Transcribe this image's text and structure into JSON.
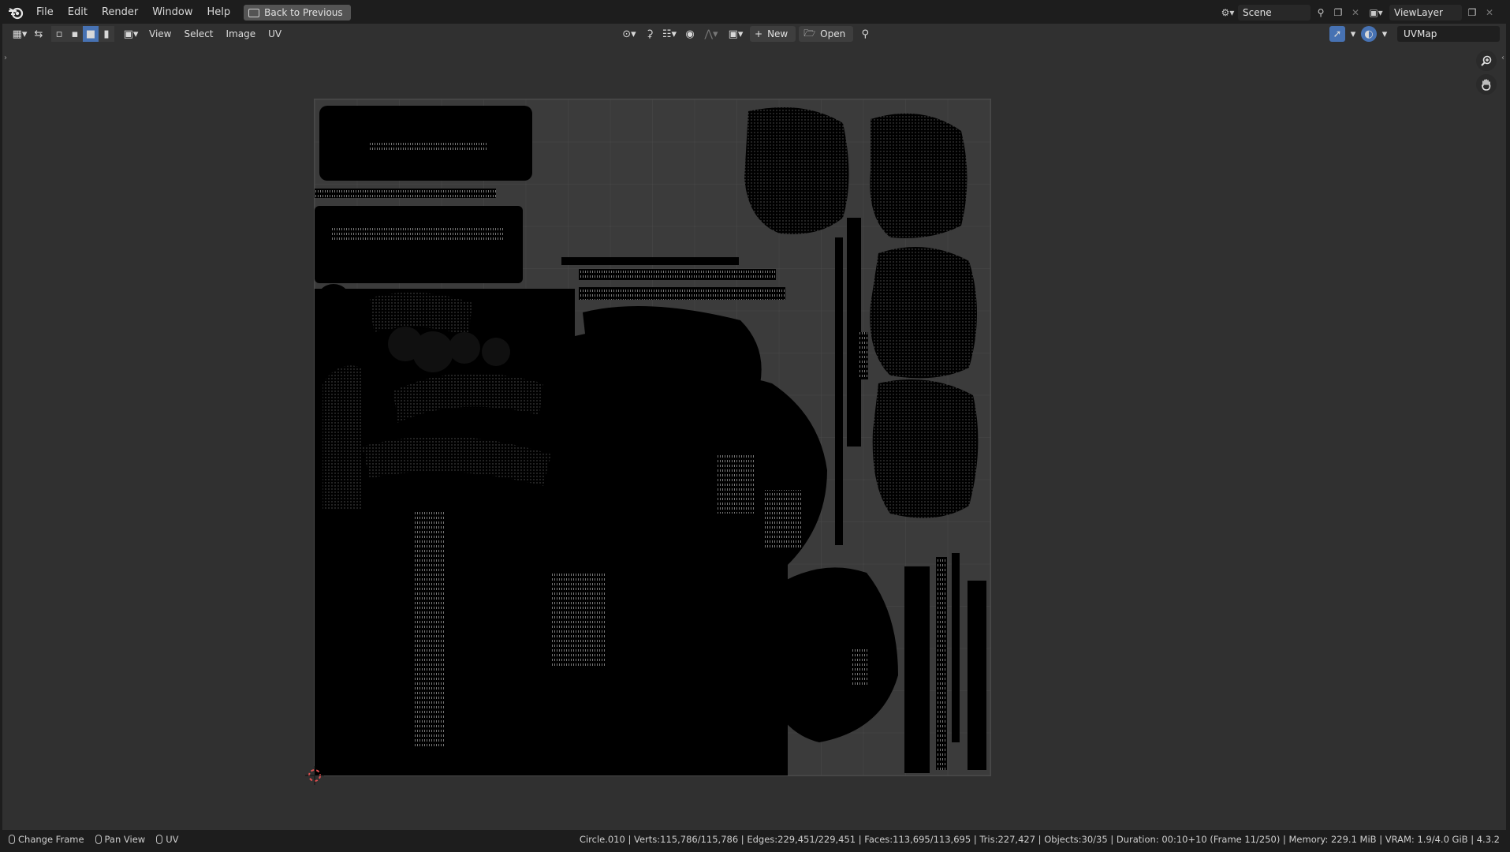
{
  "topbar": {
    "menus": [
      "File",
      "Edit",
      "Render",
      "Window",
      "Help"
    ],
    "back_label": "Back to Previous",
    "scene_name": "Scene",
    "view_layer_name": "ViewLayer"
  },
  "editor_header": {
    "menus": [
      "View",
      "Select",
      "Image",
      "UV"
    ],
    "new_label": "New",
    "open_label": "Open",
    "uv_map_name": "UVMap"
  },
  "statusbar": {
    "left": [
      "Change Frame",
      "Pan View",
      "UV"
    ],
    "right": "Circle.010 | Verts:115,786/115,786 | Edges:229,451/229,451 | Faces:113,695/113,695 | Tris:227,427 | Objects:30/35 | Duration: 00:10+10 (Frame 11/250) | Memory: 229.1 MiB | VRAM: 1.9/4.0 GiB | 4.3.2"
  },
  "colors": {
    "accent": "#4772b3",
    "uv_islands": "#000000",
    "background": "#303030"
  }
}
